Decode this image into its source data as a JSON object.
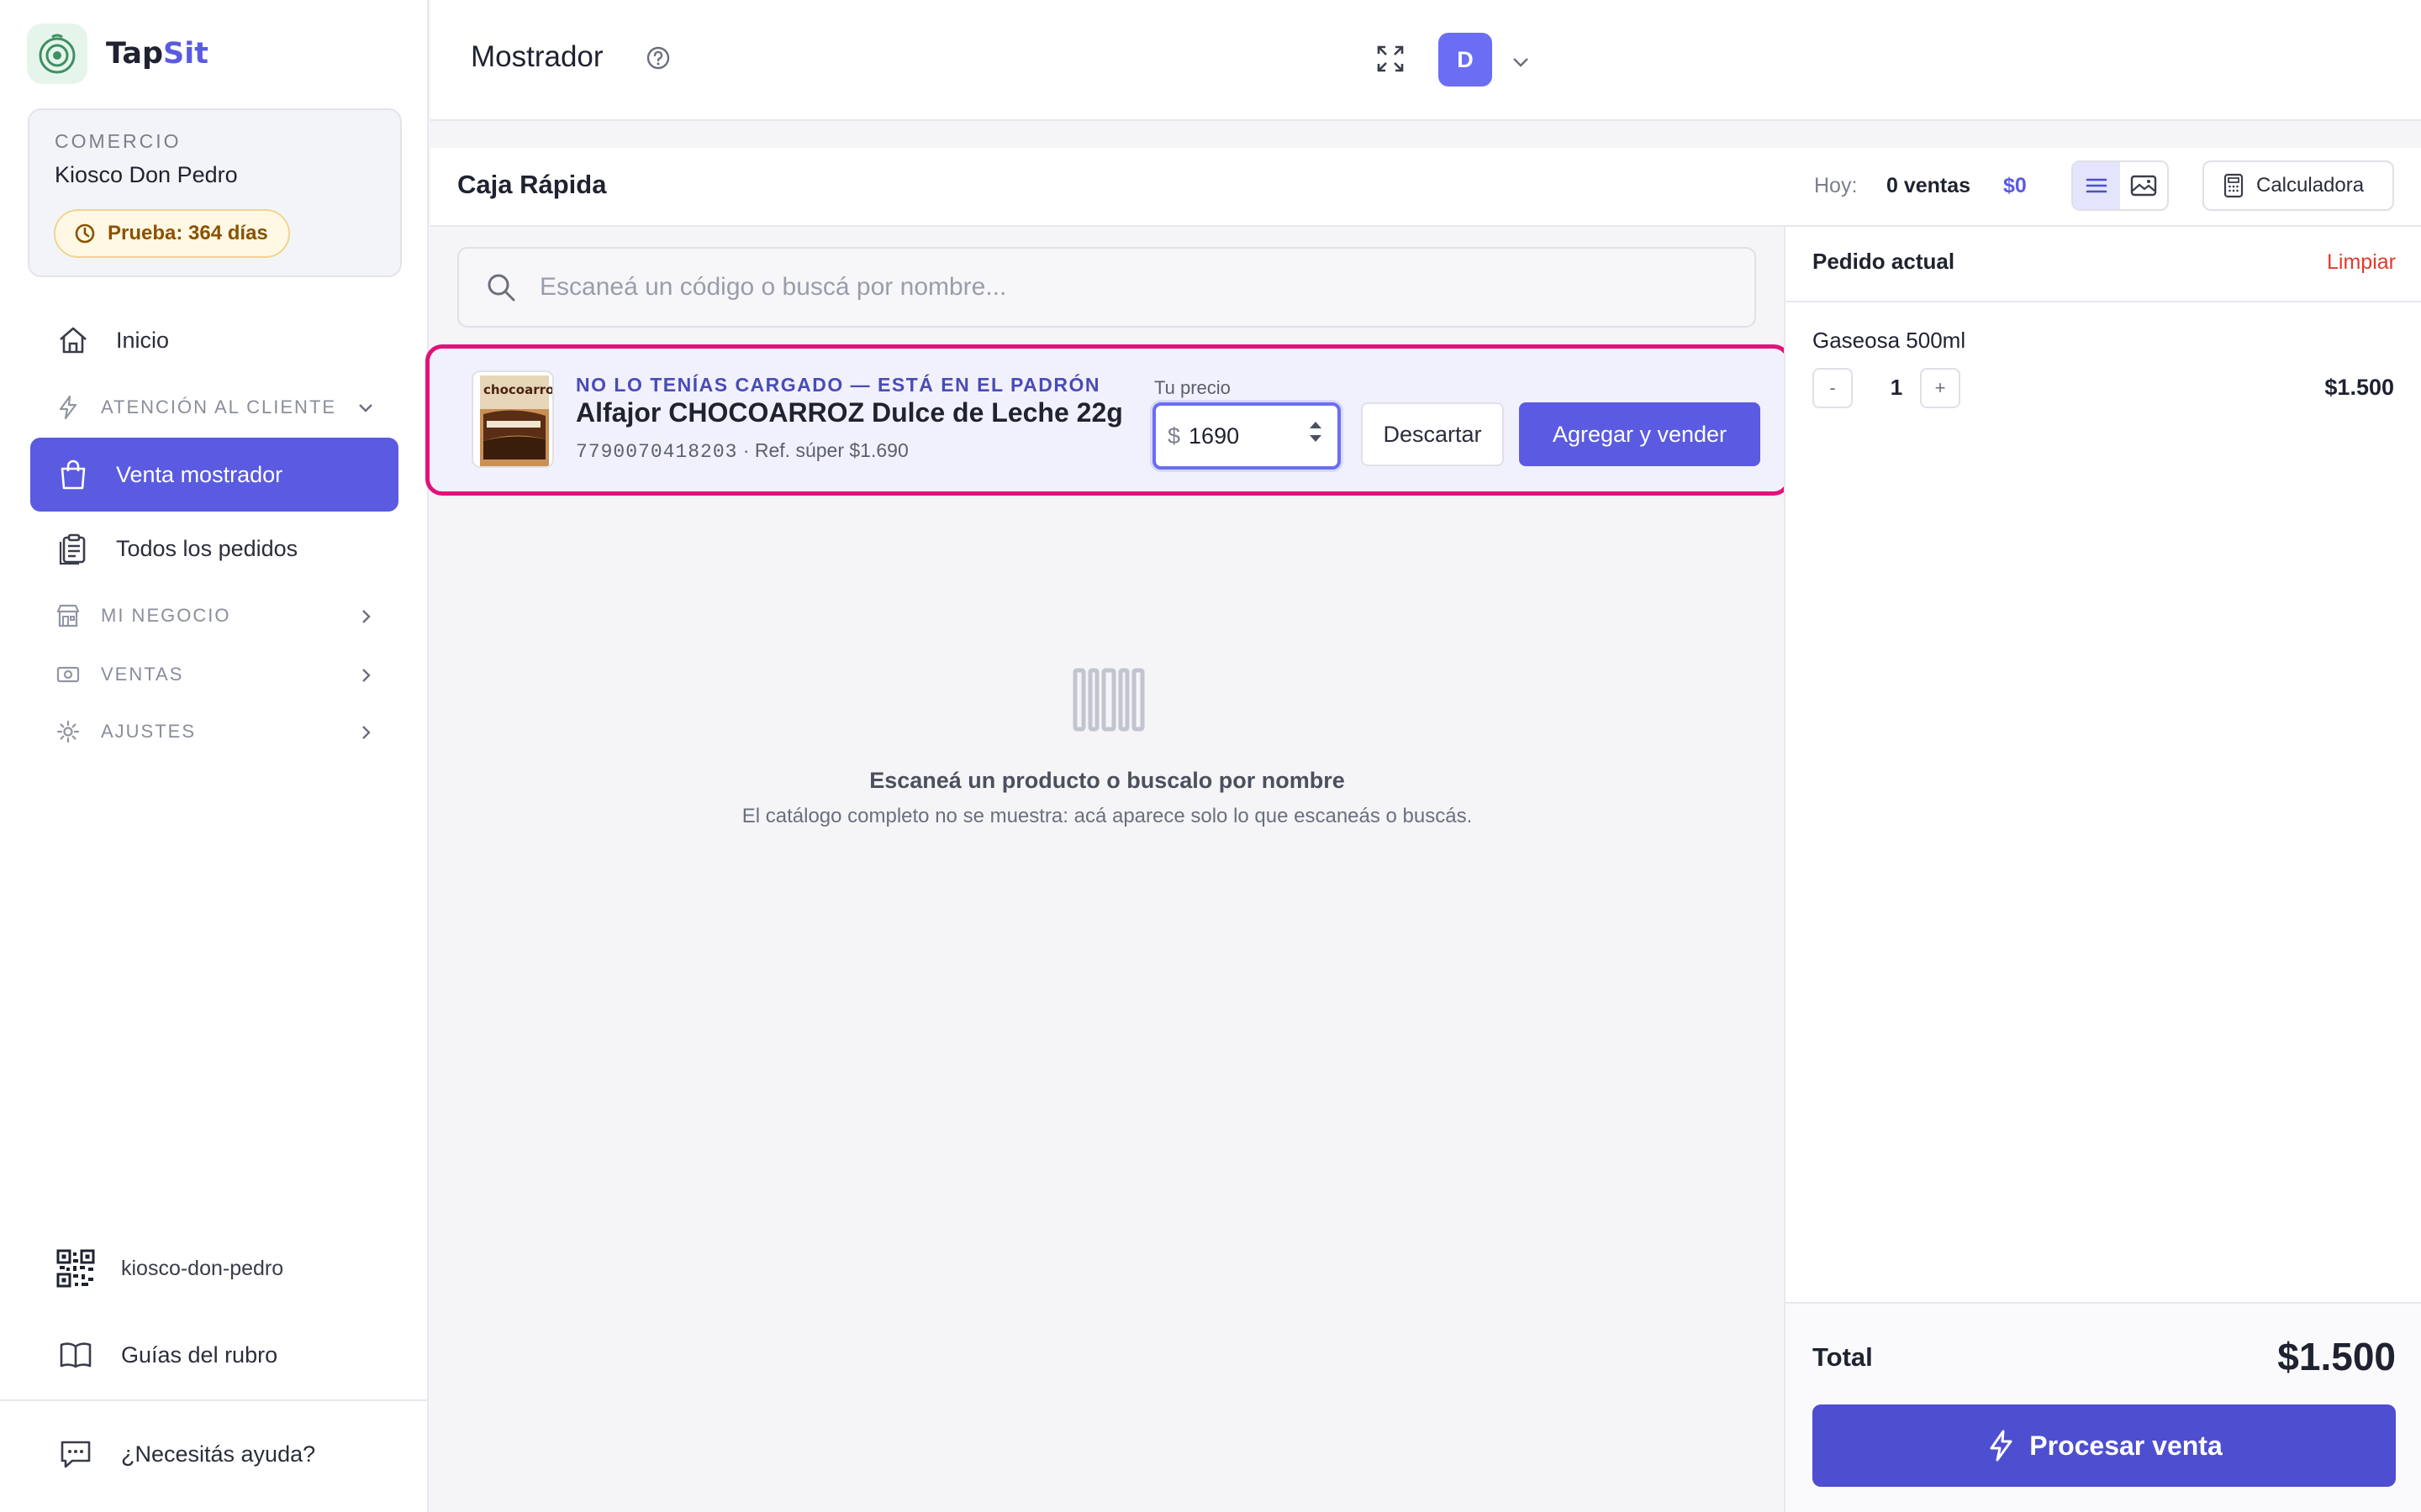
{
  "brand": {
    "name_prefix": "Tap",
    "name_suffix": "Sit"
  },
  "store": {
    "kicker": "COMERCIO",
    "name": "Kiosco Don Pedro",
    "trial": "Prueba: 364 días"
  },
  "nav": {
    "inicio": "Inicio",
    "atencion": "ATENCIÓN AL CLIENTE",
    "venta_mostrador": "Venta mostrador",
    "todos_pedidos": "Todos los pedidos",
    "mi_negocio": "MI NEGOCIO",
    "ventas": "VENTAS",
    "ajustes": "AJUSTES"
  },
  "sidebar_bottom": {
    "slug": "kiosco-don-pedro",
    "guides": "Guías del rubro",
    "help": "¿Necesitás ayuda?"
  },
  "topbar": {
    "title": "Mostrador",
    "avatar_letter": "D"
  },
  "panel": {
    "title": "Caja Rápida",
    "today_label": "Hoy:",
    "today_sales": "0 ventas",
    "today_amount": "$0",
    "calculator": "Calculadora"
  },
  "search": {
    "placeholder": "Escaneá un código o buscá por nombre...",
    "value": ""
  },
  "found": {
    "kicker": "NO LO TENÍAS CARGADO — ESTÁ EN EL PADRÓN",
    "name": "Alfajor CHOCOARROZ Dulce de Leche 22g",
    "barcode": "7790070418203",
    "separator": "·",
    "reference": "Ref. súper $1.690",
    "price_label": "Tu precio",
    "currency": "$",
    "price_value": "1690",
    "discard": "Descartar",
    "add": "Agregar y vender",
    "thumb_brand": "chocoarroz"
  },
  "empty": {
    "title": "Escaneá un producto o buscalo por nombre",
    "subtitle": "El catálogo completo no se muestra: acá aparece solo lo que escaneás o buscás."
  },
  "order": {
    "title": "Pedido actual",
    "clear": "Limpiar",
    "items": [
      {
        "name": "Gaseosa 500ml",
        "qty": "1",
        "price": "$1.500",
        "minus": "-",
        "plus": "+"
      }
    ],
    "total_label": "Total",
    "total_value": "$1.500",
    "process": "Procesar venta"
  },
  "colors": {
    "accent": "#5a5be0",
    "highlight": "#e0137c",
    "danger": "#e23a2a",
    "trial": "#8a5200"
  }
}
